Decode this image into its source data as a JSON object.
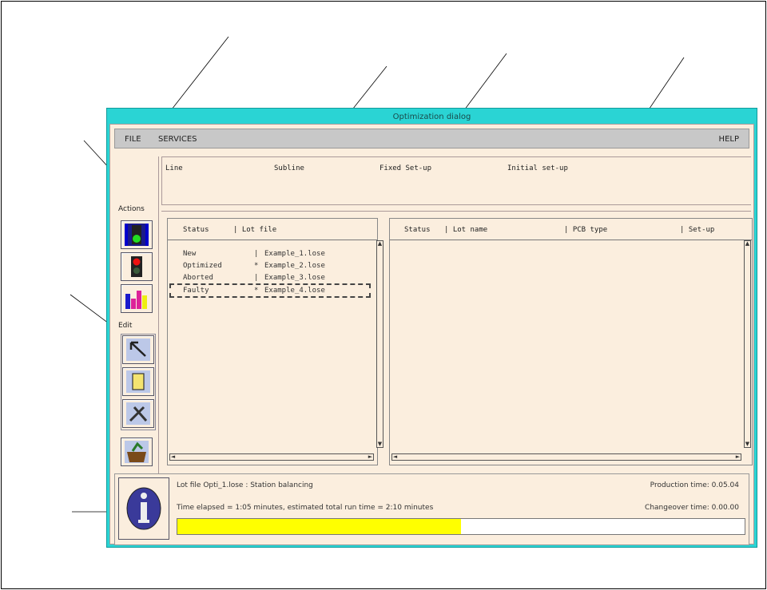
{
  "window": {
    "title": "Optimization dialog"
  },
  "menu": {
    "file": "FILE",
    "services": "SERVICES",
    "help": "HELP"
  },
  "header": {
    "line": "Line",
    "subline": "Subline",
    "fixed_setup": "Fixed Set-up",
    "initial_setup": "Initial set-up"
  },
  "toolbar": {
    "actions_label": "Actions",
    "edit_label": "Edit"
  },
  "lot_list": {
    "columns": [
      "Status",
      "| Lot file"
    ],
    "rows": [
      {
        "status": "New",
        "sep": "|",
        "file": "Example_1.lose"
      },
      {
        "status": "Optimized",
        "sep": "*",
        "file": "Example_2.lose"
      },
      {
        "status": "Aborted",
        "sep": "|",
        "file": "Example_3.lose"
      },
      {
        "status": "Faulty",
        "sep": "*",
        "file": "Example_4.lose"
      }
    ]
  },
  "lot_detail": {
    "columns": [
      "Status",
      "| Lot name",
      "| PCB type",
      "| Set-up"
    ]
  },
  "status": {
    "lot_file_text": "Lot file Opti_1.lose : Station balancing",
    "time_text": "Time elapsed = 1:05 minutes, estimated total run time = 2:10 minutes",
    "production_time": "Production time: 0.05.04",
    "changeover_time": "Changeover time: 0.00.00",
    "progress_fraction": 0.5
  },
  "icons": [
    "traffic-light-green-icon",
    "traffic-light-red-icon",
    "bar-chart-icon",
    "pointer-arrow-icon",
    "document-icon",
    "tools-icon",
    "basket-icon",
    "info-icon"
  ],
  "colors": {
    "title_bar": "#2ad4d4",
    "progress": "#ffff00",
    "panel_bg": "#fbeede"
  }
}
